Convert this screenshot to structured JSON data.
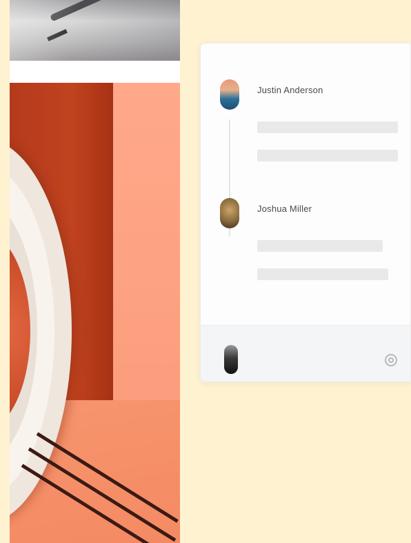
{
  "images": {
    "top_photo": "pen-on-paper-photo",
    "art_photo": "orange-room-with-white-ring-photo"
  },
  "activity_card": {
    "entries": [
      {
        "name": "Justin Anderson",
        "avatar": "user-avatar"
      },
      {
        "name": "Joshua Miller",
        "avatar": "user-avatar"
      }
    ],
    "footer": {
      "avatar": "current-user-avatar",
      "icon": "settings-icon"
    }
  },
  "colors": {
    "page_background": "#fff2d1",
    "card_background": "#fdfdfd",
    "placeholder_line": "#e9e9e9",
    "footer_background": "#f4f5f7",
    "accent_orange": "#f8926d",
    "accent_dark_red": "#b43a1c"
  }
}
